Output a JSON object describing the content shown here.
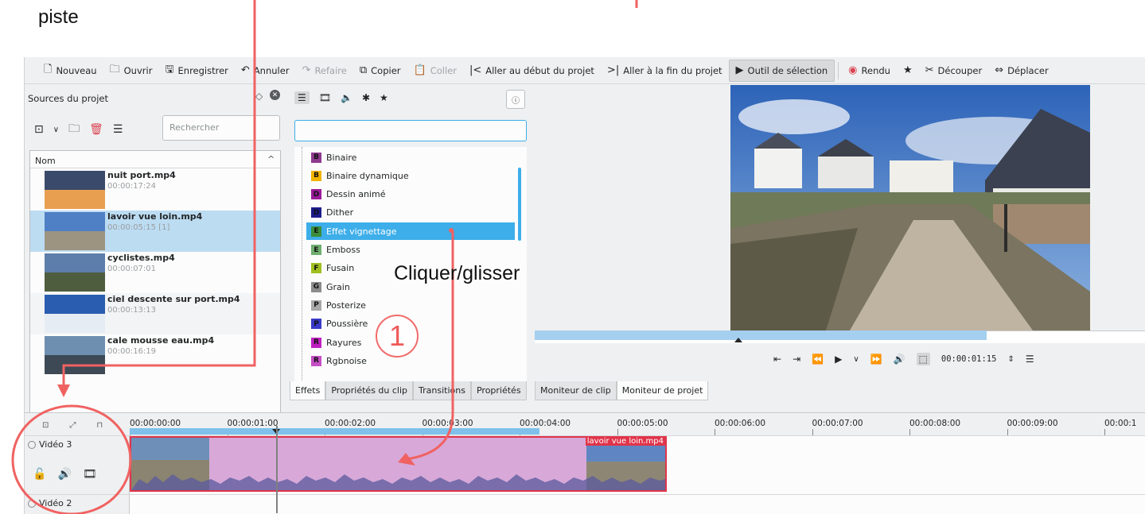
{
  "annotation": {
    "piste": "piste",
    "cliquer": "Cliquer/glisser",
    "step_number": "1",
    "color": "#f06262"
  },
  "toolbar": {
    "items": [
      {
        "icon": "new-file-icon",
        "label": "Nouveau",
        "enabled": true
      },
      {
        "icon": "open-folder-icon",
        "label": "Ouvrir",
        "enabled": true
      },
      {
        "icon": "save-icon",
        "label": "Enregistrer",
        "enabled": true
      },
      {
        "icon": "undo-icon",
        "label": "Annuler",
        "enabled": true
      },
      {
        "icon": "redo-icon",
        "label": "Refaire",
        "enabled": false
      },
      {
        "icon": "copy-icon",
        "label": "Copier",
        "enabled": true
      },
      {
        "icon": "paste-icon",
        "label": "Coller",
        "enabled": false
      },
      {
        "icon": "go-start-icon",
        "label": "Aller au début du projet",
        "enabled": true
      },
      {
        "icon": "go-end-icon",
        "label": "Aller à la fin du projet",
        "enabled": true
      },
      {
        "icon": "select-tool-icon",
        "label": "Outil de sélection",
        "enabled": true,
        "active": true
      },
      {
        "icon": "render-icon",
        "label": "Rendu",
        "enabled": true
      },
      {
        "icon": "star-icon",
        "label": "",
        "enabled": true
      },
      {
        "icon": "cut-icon",
        "label": "Découper",
        "enabled": true
      },
      {
        "icon": "move-icon",
        "label": "Déplacer",
        "enabled": true
      }
    ]
  },
  "bin": {
    "title": "Sources du projet",
    "search_placeholder": "Rechercher",
    "column_header": "Nom",
    "clips": [
      {
        "name": "nuit port.mp4",
        "duration": "00:00:17:24",
        "thumb": "sunset"
      },
      {
        "name": "lavoir vue loin.mp4",
        "duration": "00:00:05:15 [1]",
        "thumb": "path",
        "selected": true
      },
      {
        "name": "cyclistes.mp4",
        "duration": "00:00:07:01",
        "thumb": "coast"
      },
      {
        "name": "ciel descente sur port.mp4",
        "duration": "00:00:13:13",
        "thumb": "sky"
      },
      {
        "name": "cale mousse eau.mp4",
        "duration": "00:00:16:19",
        "thumb": "sea"
      }
    ]
  },
  "effects": {
    "items": [
      {
        "letter": "B",
        "label": "Binaire",
        "color": "#8e3a8e"
      },
      {
        "letter": "B",
        "label": "Binaire dynamique",
        "color": "#f0b400"
      },
      {
        "letter": "D",
        "label": "Dessin animé",
        "color": "#9a1a9a"
      },
      {
        "letter": "D",
        "label": "Dither",
        "color": "#1c1c8c"
      },
      {
        "letter": "E",
        "label": "Effet vignettage",
        "color": "#3a8e3a",
        "selected": true
      },
      {
        "letter": "E",
        "label": "Emboss",
        "color": "#6fae6f"
      },
      {
        "letter": "F",
        "label": "Fusain",
        "color": "#a0c020"
      },
      {
        "letter": "G",
        "label": "Grain",
        "color": "#8c8c8c"
      },
      {
        "letter": "P",
        "label": "Posterize",
        "color": "#a8a8a8"
      },
      {
        "letter": "P",
        "label": "Poussière",
        "color": "#3a3ac8"
      },
      {
        "letter": "R",
        "label": "Rayures",
        "color": "#c020c0"
      },
      {
        "letter": "R",
        "label": "Rgbnoise",
        "color": "#c44ec4"
      }
    ],
    "bottom_tabs": [
      "Effets",
      "Propriétés du clip",
      "Transitions",
      "Propriétés"
    ]
  },
  "monitor": {
    "timecode": "00:00:01:15",
    "progress": 0.74,
    "tabs": [
      "Moniteur de clip",
      "Moniteur de projet"
    ]
  },
  "timeline": {
    "ruler": [
      "00:00:00:00",
      "00:00:01:00",
      "00:00:02:00",
      "00:00:03:00",
      "00:00:04:00",
      "00:00:05:00",
      "00:00:06:00",
      "00:00:07:00",
      "00:00:08:00",
      "00:00:09:00",
      "00:00:1"
    ],
    "tracks": [
      {
        "name": "Vidéo 3"
      },
      {
        "name": "Vidéo 2"
      }
    ],
    "clip_label": "lavoir vue loin.mp4"
  }
}
